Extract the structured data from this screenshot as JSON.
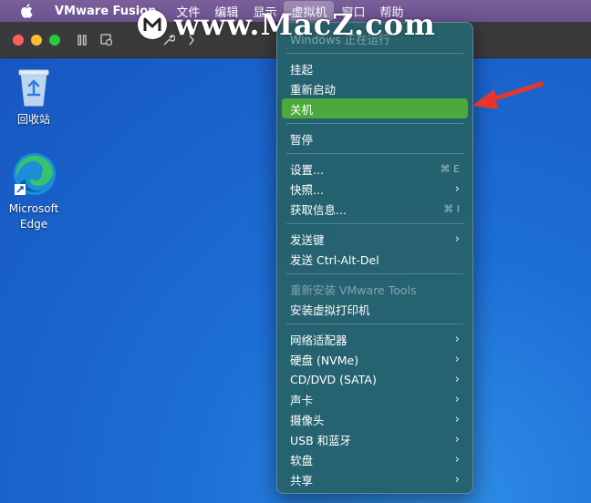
{
  "menubar": {
    "app_name": "VMware Fusion",
    "items": [
      "文件",
      "编辑",
      "显示",
      "虚拟机",
      "窗口",
      "帮助"
    ]
  },
  "watermark": {
    "text": "www.MacZ.com"
  },
  "desktop": {
    "recycle_bin_label": "回收站",
    "edge_label": "Microsoft Edge"
  },
  "vm_menu": {
    "status": "Windows 正在运行",
    "suspend": "挂起",
    "restart": "重新启动",
    "shutdown": "关机",
    "pause": "暂停",
    "settings": "设置...",
    "settings_shortcut": "⌘ E",
    "snapshots": "快照...",
    "get_info": "获取信息...",
    "get_info_shortcut": "⌘ I",
    "send_key": "发送键",
    "send_cad": "发送 Ctrl-Alt-Del",
    "reinstall_tools": "重新安装 VMware Tools",
    "install_printer": "安装虚拟打印机",
    "network_adapter": "网络适配器",
    "hard_disk": "硬盘 (NVMe)",
    "cd_dvd": "CD/DVD (SATA)",
    "sound_card": "声卡",
    "camera": "摄像头",
    "usb_bluetooth": "USB 和蓝牙",
    "floppy": "软盘",
    "sharing": "共享"
  },
  "colors": {
    "menu_bg": "#26626c",
    "highlight": "#4caa3c",
    "annotation_arrow": "#e8352b"
  }
}
